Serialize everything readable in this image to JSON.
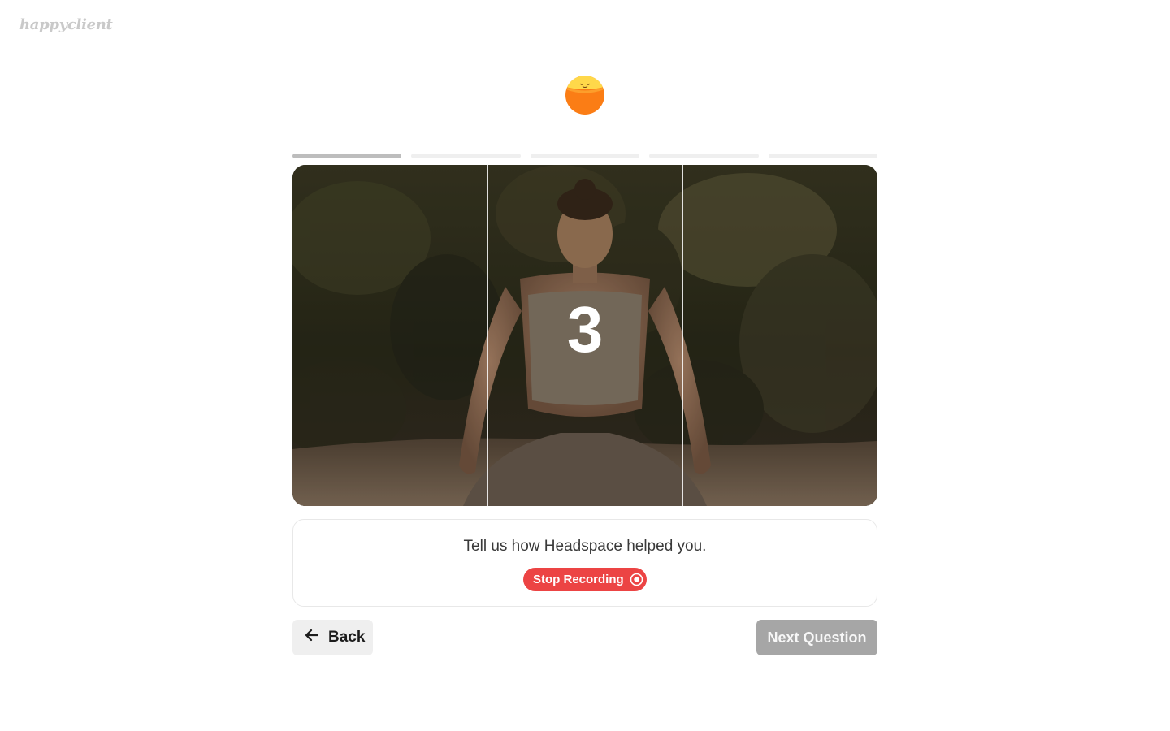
{
  "brand": {
    "logo_text": "happyclient"
  },
  "header": {
    "avatar_icon": "sunset-avatar-icon"
  },
  "progress": {
    "total_steps": 5,
    "current_step": 1
  },
  "video": {
    "countdown": "3",
    "recording_state": "countdown"
  },
  "question": {
    "text": "Tell us how Headspace helped you.",
    "stop_label": "Stop Recording",
    "stop_icon": "record-icon",
    "stop_color": "#ec4444"
  },
  "nav": {
    "back_label": "Back",
    "back_icon": "arrow-left-icon",
    "next_label": "Next Question",
    "next_enabled": false
  }
}
